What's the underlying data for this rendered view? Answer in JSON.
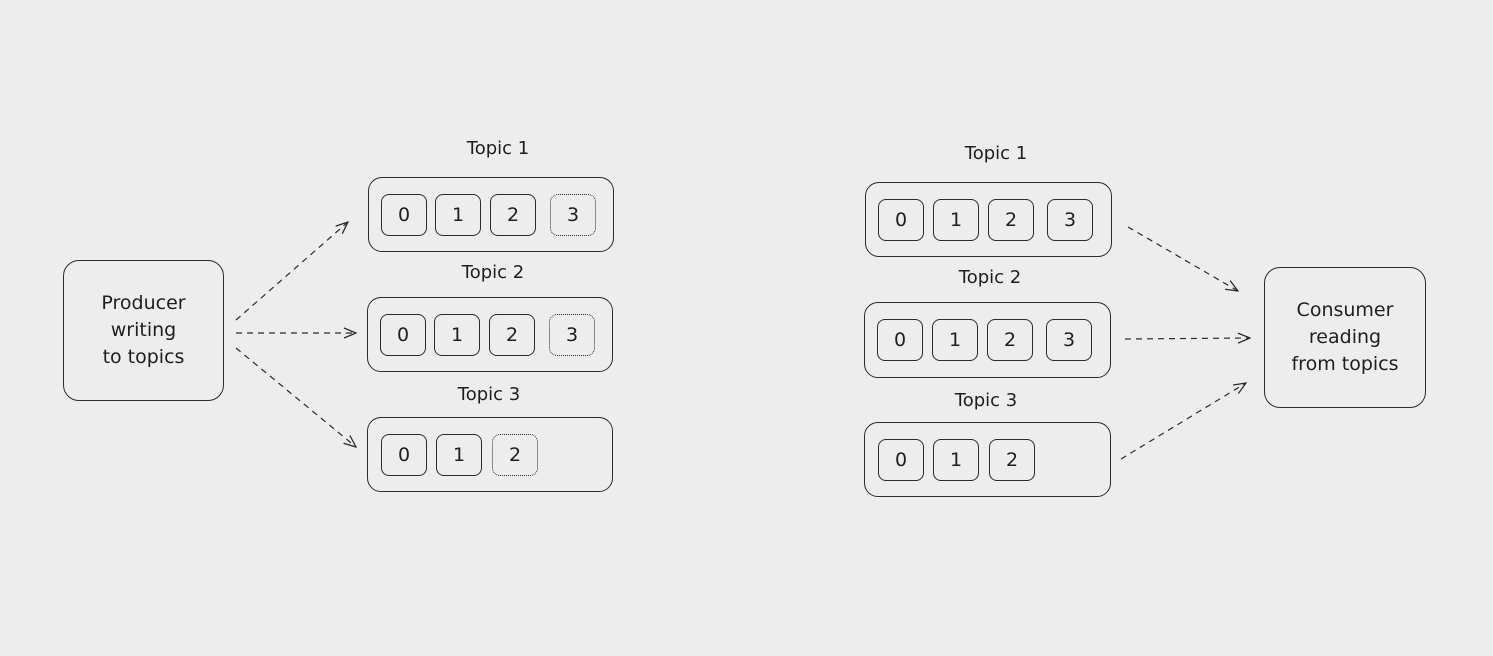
{
  "producer": {
    "lines": [
      "Producer",
      "writing",
      "to topics"
    ]
  },
  "consumer": {
    "lines": [
      "Consumer",
      "reading",
      "from topics"
    ]
  },
  "producer_topics": [
    {
      "title": "Topic 1",
      "partitions": [
        {
          "label": "0",
          "pending": false
        },
        {
          "label": "1",
          "pending": false
        },
        {
          "label": "2",
          "pending": false
        },
        {
          "label": "3",
          "pending": true
        }
      ]
    },
    {
      "title": "Topic 2",
      "partitions": [
        {
          "label": "0",
          "pending": false
        },
        {
          "label": "1",
          "pending": false
        },
        {
          "label": "2",
          "pending": false
        },
        {
          "label": "3",
          "pending": true
        }
      ]
    },
    {
      "title": "Topic 3",
      "partitions": [
        {
          "label": "0",
          "pending": false
        },
        {
          "label": "1",
          "pending": false
        },
        {
          "label": "2",
          "pending": true
        }
      ]
    }
  ],
  "consumer_topics": [
    {
      "title": "Topic 1",
      "partitions": [
        {
          "label": "0",
          "pending": false
        },
        {
          "label": "1",
          "pending": false
        },
        {
          "label": "2",
          "pending": false
        },
        {
          "label": "3",
          "pending": false
        }
      ]
    },
    {
      "title": "Topic 2",
      "partitions": [
        {
          "label": "0",
          "pending": false
        },
        {
          "label": "1",
          "pending": false
        },
        {
          "label": "2",
          "pending": false
        },
        {
          "label": "3",
          "pending": false
        }
      ]
    },
    {
      "title": "Topic 3",
      "partitions": [
        {
          "label": "0",
          "pending": false
        },
        {
          "label": "1",
          "pending": false
        },
        {
          "label": "2",
          "pending": false
        }
      ]
    }
  ],
  "colors": {
    "background": "#ededed",
    "stroke": "#2b2b2b",
    "text": "#1e1e1e"
  }
}
